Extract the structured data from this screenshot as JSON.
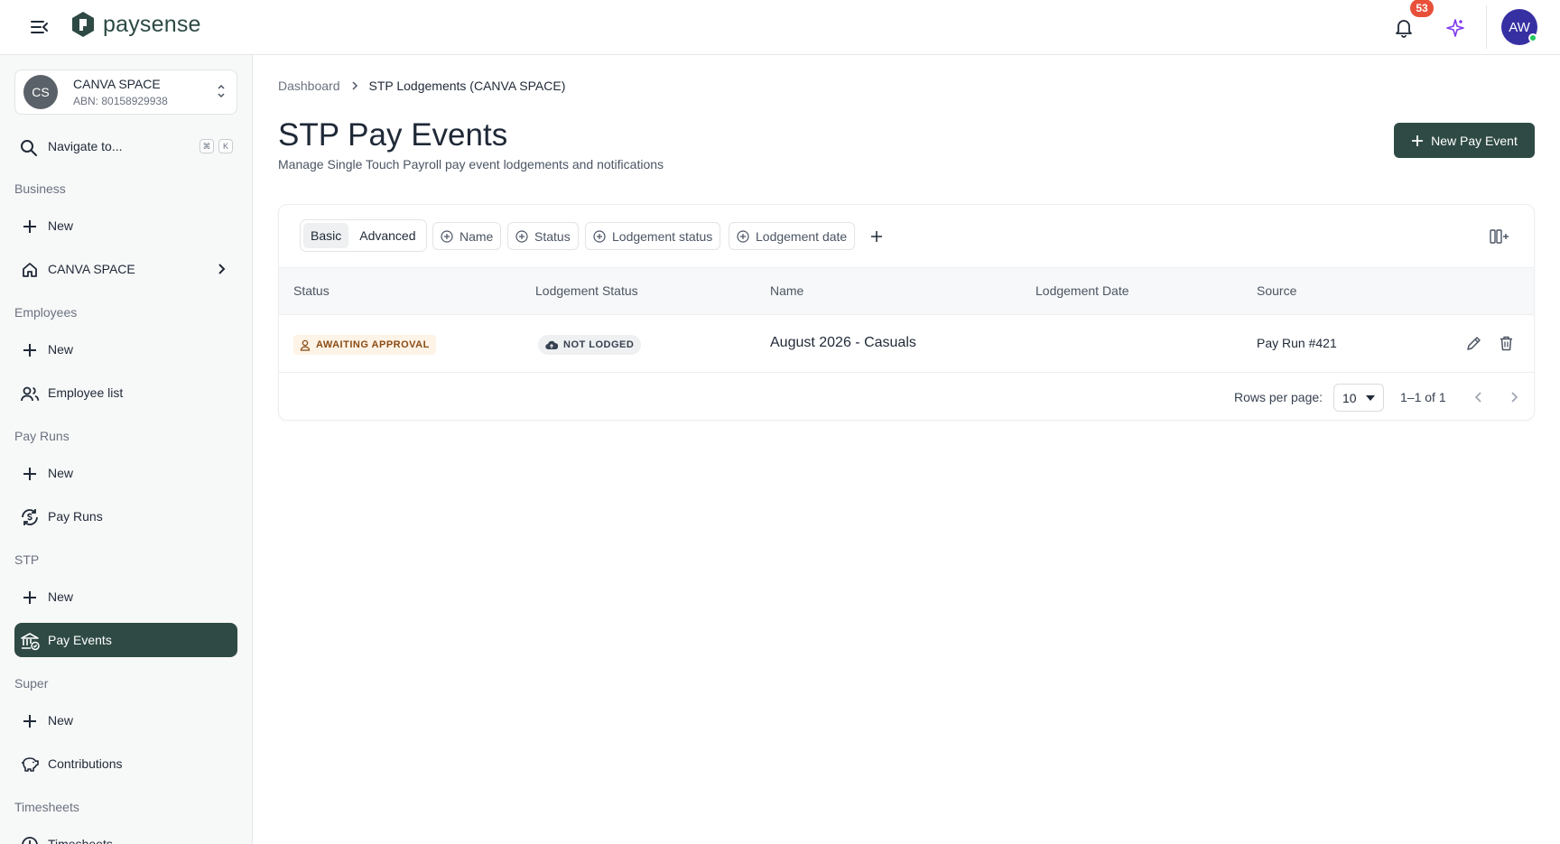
{
  "header": {
    "brand": "paysense",
    "notification_count": "53",
    "user_initials": "AW"
  },
  "sidebar": {
    "org": {
      "initials": "CS",
      "name": "CANVA SPACE",
      "abn": "ABN: 80158929938"
    },
    "search": {
      "label": "Navigate to...",
      "kbd_cmd": "⌘",
      "kbd_key": "K"
    },
    "sections": {
      "business": "Business",
      "employees": "Employees",
      "pay_runs": "Pay Runs",
      "stp": "STP",
      "super": "Super",
      "timesheets": "Timesheets"
    },
    "items": {
      "business_new": "New",
      "business_org": "CANVA SPACE",
      "employees_new": "New",
      "employee_list": "Employee list",
      "payruns_new": "New",
      "pay_runs": "Pay Runs",
      "stp_new": "New",
      "pay_events": "Pay Events",
      "super_new": "New",
      "contributions": "Contributions",
      "timesheets": "Timesheets"
    }
  },
  "breadcrumb": {
    "parent": "Dashboard",
    "current": "STP Lodgements (CANVA SPACE)"
  },
  "page": {
    "title": "STP Pay Events",
    "subtitle": "Manage Single Touch Payroll pay event lodgements and notifications",
    "primary_action": "New Pay Event"
  },
  "filters": {
    "mode_basic": "Basic",
    "mode_advanced": "Advanced",
    "chips": [
      "Name",
      "Status",
      "Lodgement status",
      "Lodgement date"
    ]
  },
  "table": {
    "columns": [
      "Status",
      "Lodgement Status",
      "Name",
      "Lodgement Date",
      "Source"
    ],
    "rows": [
      {
        "status": "AWAITING APPROVAL",
        "lodgement_status": "NOT LODGED",
        "name": "August 2026 - Casuals",
        "lodgement_date": "",
        "source": "Pay Run #421"
      }
    ]
  },
  "pagination": {
    "rows_per_page_label": "Rows per page:",
    "rows_per_page": "10",
    "range": "1–1 of 1"
  },
  "colors": {
    "brand": "#2f4a44",
    "badge": "#e8503a",
    "avatar": "#3730a3",
    "status_awaiting_bg": "#fdf3e6",
    "status_awaiting_text": "#8a4b14"
  }
}
